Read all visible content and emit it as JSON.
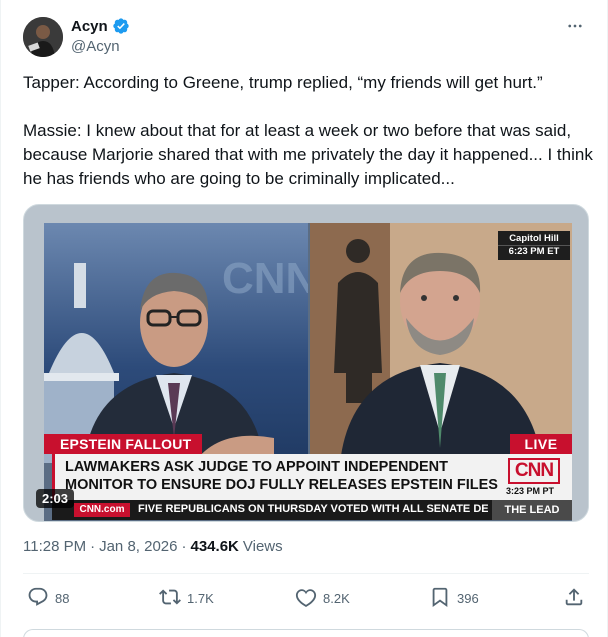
{
  "post": {
    "author_name": "Acyn",
    "author_handle": "@Acyn",
    "paragraphs": [
      "Tapper: According to Greene, trump replied, “my friends will get hurt.”",
      "Massie: I knew about that for at least a week or two before that was said, because Marjorie shared that with me privately the day it happened... I think he has friends who are going to be criminally implicated..."
    ],
    "time": "11:28 PM",
    "date": "Jan 8, 2026",
    "views_count": "434.6K",
    "views_label": "Views"
  },
  "video": {
    "duration": "2:03",
    "location": "Capitol Hill",
    "location_time": "6:23 PM ET",
    "chyron_tag": "EPSTEIN FALLOUT",
    "live_label": "LIVE",
    "headline_line1": "LAWMAKERS ASK JUDGE TO APPOINT INDEPENDENT",
    "headline_line2": "MONITOR TO ENSURE DOJ FULLY RELEASES EPSTEIN FILES",
    "network_logo": "CNN",
    "chyron_time": "3:23 PM PT",
    "ticker_brand": "CNN.com",
    "ticker_text": "FIVE REPUBLICANS ON THURSDAY VOTED WITH ALL SENATE DEMOC",
    "show_name": "THE LEAD",
    "bg_logo": "CNN"
  },
  "actions": {
    "replies": "88",
    "reposts": "1.7K",
    "likes": "8.2K",
    "bookmarks": "396"
  },
  "icons": {
    "verified": "verified-badge-icon",
    "more": "more-icon",
    "reply": "reply-icon",
    "repost": "repost-icon",
    "like": "heart-icon",
    "bookmark": "bookmark-icon",
    "share": "share-icon"
  },
  "colors": {
    "verified": "#1d9bf0",
    "secondary_text": "#536471",
    "cnn_red": "#c8102e"
  }
}
